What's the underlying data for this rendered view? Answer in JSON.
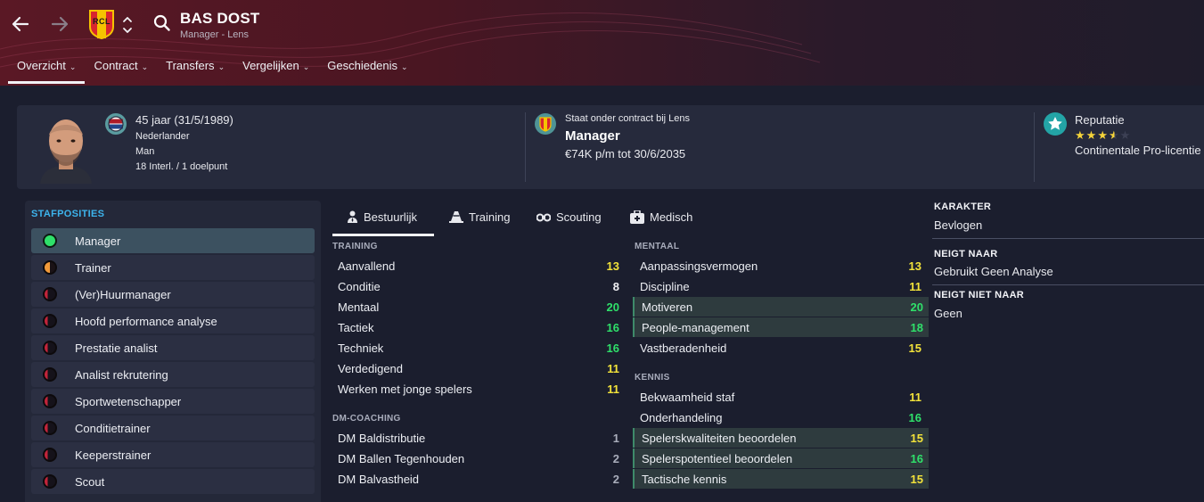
{
  "header": {
    "title": "BAS DOST",
    "subtitle": "Manager - Lens",
    "club_badge_text": "RCL"
  },
  "nav_tabs": [
    {
      "label": "Overzicht",
      "active": true
    },
    {
      "label": "Contract",
      "active": false
    },
    {
      "label": "Transfers",
      "active": false
    },
    {
      "label": "Vergelijken",
      "active": false
    },
    {
      "label": "Geschiedenis",
      "active": false
    }
  ],
  "profile": {
    "age": "45 jaar (31/5/1989)",
    "nationality": "Nederlander",
    "gender": "Man",
    "caps": "18 Interl. / 1 doelpunt",
    "contract_club": "Staat onder contract bij Lens",
    "role": "Manager",
    "wage": "€74K p/m tot 30/6/2035",
    "reputation_label": "Reputatie",
    "reputation_stars": 3.5,
    "reputation_max": 5,
    "licence": "Continentale Pro-licentie"
  },
  "staff_positions": {
    "title": "STAFPOSITIES",
    "items": [
      {
        "label": "Manager",
        "level": "full"
      },
      {
        "label": "Trainer",
        "level": "half"
      },
      {
        "label": "(Ver)Huurmanager",
        "level": "low"
      },
      {
        "label": "Hoofd performance analyse",
        "level": "low"
      },
      {
        "label": "Prestatie analist",
        "level": "low"
      },
      {
        "label": "Analist rekrutering",
        "level": "low"
      },
      {
        "label": "Sportwetenschapper",
        "level": "low"
      },
      {
        "label": "Conditietrainer",
        "level": "low"
      },
      {
        "label": "Keeperstrainer",
        "level": "low"
      },
      {
        "label": "Scout",
        "level": "low"
      }
    ]
  },
  "attr_tabs": [
    {
      "label": "Bestuurlijk",
      "icon": "person-tie-icon",
      "active": true
    },
    {
      "label": "Training",
      "icon": "cone-icon",
      "active": false
    },
    {
      "label": "Scouting",
      "icon": "binoculars-icon",
      "active": false
    },
    {
      "label": "Medisch",
      "icon": "medical-kit-icon",
      "active": false
    }
  ],
  "training": {
    "title": "TRAINING",
    "items": [
      {
        "name": "Aanvallend",
        "value": "13"
      },
      {
        "name": "Conditie",
        "value": "8"
      },
      {
        "name": "Mentaal",
        "value": "20"
      },
      {
        "name": "Tactiek",
        "value": "16"
      },
      {
        "name": "Techniek",
        "value": "16"
      },
      {
        "name": "Verdedigend",
        "value": "11"
      },
      {
        "name": "Werken met jonge spelers",
        "value": "11"
      }
    ]
  },
  "dm_coaching": {
    "title": "DM-COACHING",
    "items": [
      {
        "name": "DM Baldistributie",
        "value": "1"
      },
      {
        "name": "DM Ballen Tegenhouden",
        "value": "2"
      },
      {
        "name": "DM Balvastheid",
        "value": "2"
      }
    ]
  },
  "mentaal": {
    "title": "MENTAAL",
    "items": [
      {
        "name": "Aanpassingsvermogen",
        "value": "13",
        "highlight": false
      },
      {
        "name": "Discipline",
        "value": "11",
        "highlight": false
      },
      {
        "name": "Motiveren",
        "value": "20",
        "highlight": true
      },
      {
        "name": "People-management",
        "value": "18",
        "highlight": true
      },
      {
        "name": "Vastberadenheid",
        "value": "15",
        "highlight": false
      }
    ]
  },
  "kennis": {
    "title": "KENNIS",
    "items": [
      {
        "name": "Bekwaamheid staf",
        "value": "11",
        "highlight": false
      },
      {
        "name": "Onderhandeling",
        "value": "16",
        "highlight": false
      },
      {
        "name": "Spelerskwaliteiten beoordelen",
        "value": "15",
        "highlight": true
      },
      {
        "name": "Spelerspotentieel beoordelen",
        "value": "16",
        "highlight": true
      },
      {
        "name": "Tactische kennis",
        "value": "15",
        "highlight": true
      }
    ]
  },
  "right_side": {
    "karakter_title": "KARAKTER",
    "karakter_value": "Bevlogen",
    "neigt_title": "NEIGT NAAR",
    "neigt_value": "Gebruikt Geen Analyse",
    "neigt_niet_title": "NEIGT NIET NAAR",
    "neigt_niet_value": "Geen"
  },
  "colors": {
    "accent_blue": "#3db4ec",
    "value_green": "#2fe06a",
    "value_yellow": "#f2e23a",
    "value_white": "#f0f0f3",
    "value_grey": "#a9adbb"
  }
}
